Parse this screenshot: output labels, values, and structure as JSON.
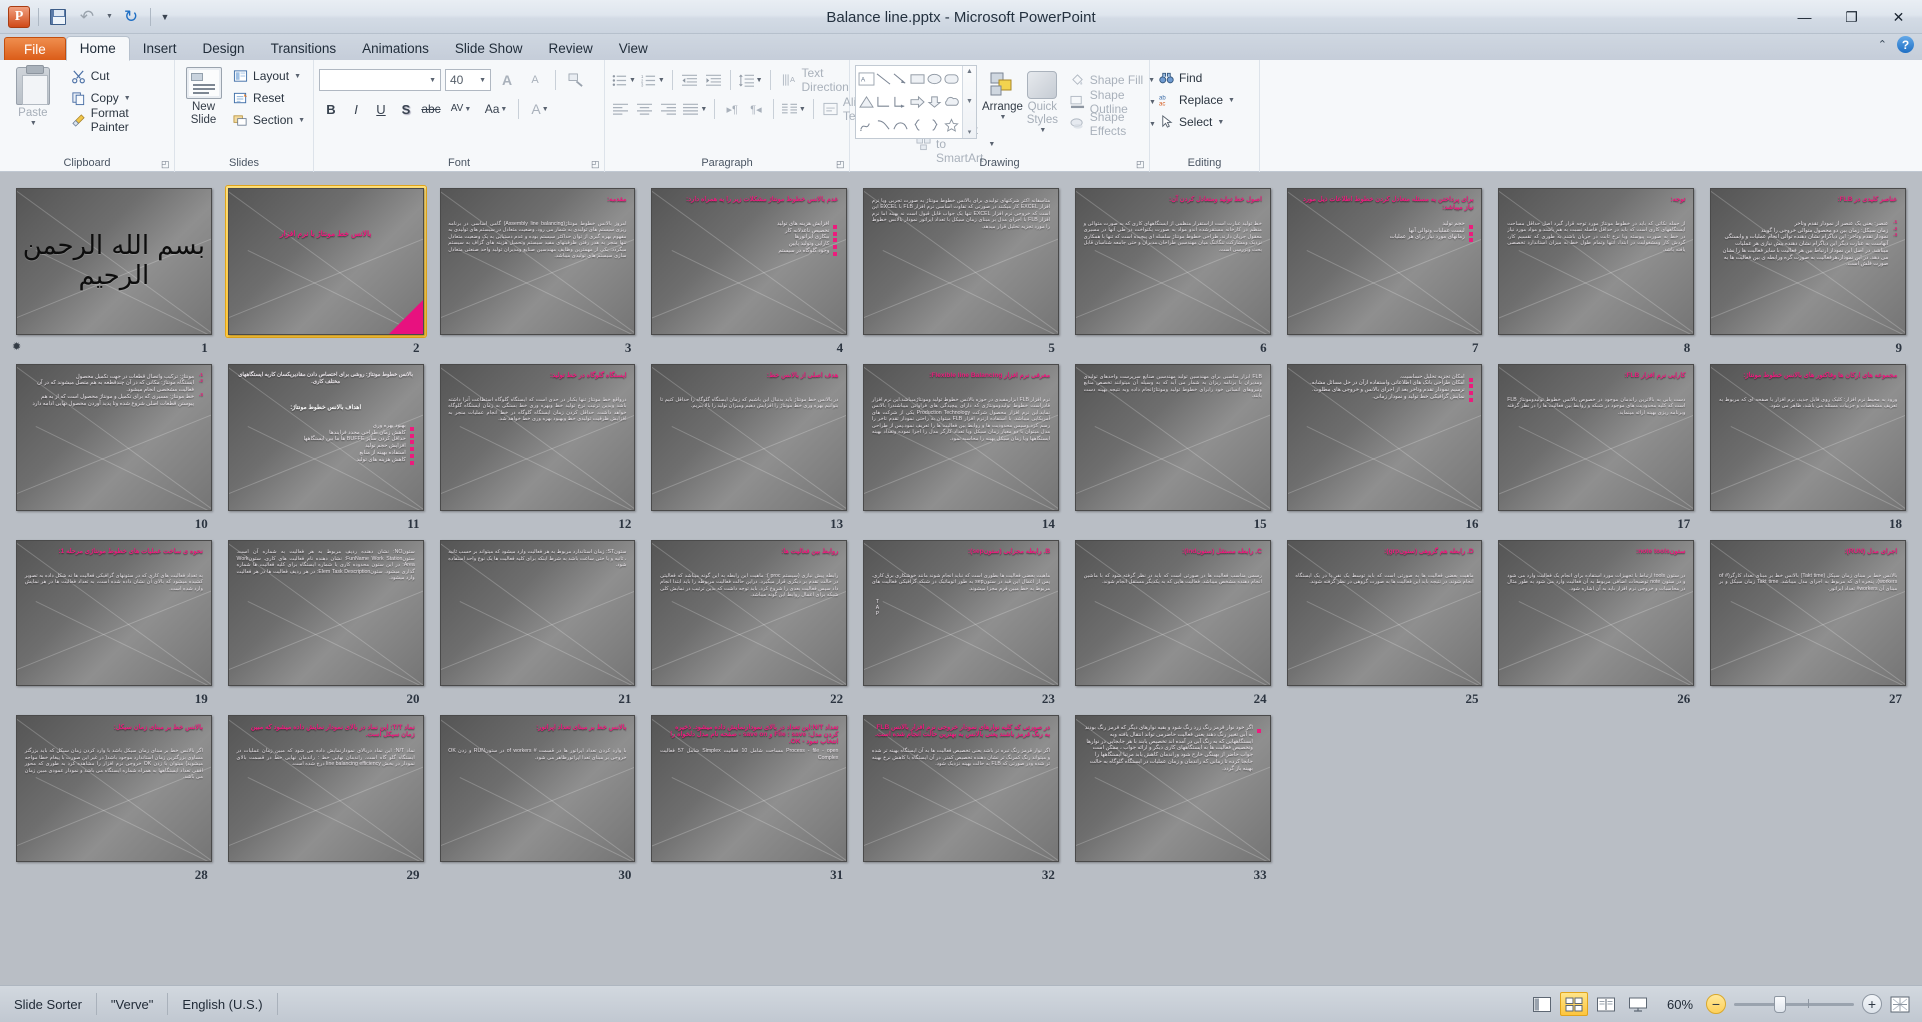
{
  "window": {
    "title": "Balance line.pptx  -  Microsoft PowerPoint",
    "minimize": "—",
    "restore": "❐",
    "close": "✕"
  },
  "qat": {
    "app_logo": "P",
    "save_icon": "save-icon",
    "undo_icon": "undo-icon",
    "redo_icon": "redo-icon",
    "customize_icon": "customize-qat-icon"
  },
  "tabs": [
    {
      "label": "File",
      "active": false,
      "file": true
    },
    {
      "label": "Home",
      "active": true,
      "file": false
    },
    {
      "label": "Insert",
      "active": false,
      "file": false
    },
    {
      "label": "Design",
      "active": false,
      "file": false
    },
    {
      "label": "Transitions",
      "active": false,
      "file": false
    },
    {
      "label": "Animations",
      "active": false,
      "file": false
    },
    {
      "label": "Slide Show",
      "active": false,
      "file": false
    },
    {
      "label": "Review",
      "active": false,
      "file": false
    },
    {
      "label": "View",
      "active": false,
      "file": false
    }
  ],
  "ribbon": {
    "groups": {
      "clipboard": {
        "label": "Clipboard",
        "paste": "Paste",
        "cut": "Cut",
        "copy": "Copy",
        "format_painter": "Format Painter"
      },
      "slides": {
        "label": "Slides",
        "new_slide": "New Slide",
        "layout": "Layout",
        "reset": "Reset",
        "section": "Section"
      },
      "font": {
        "label": "Font",
        "font_name": "",
        "font_name_placeholder": "",
        "font_size": "40",
        "bold": "B",
        "italic": "I",
        "underline": "U",
        "shadow": "S",
        "strikethrough": "abc",
        "character_spacing": "AV",
        "change_case": "Aa",
        "font_color": "A",
        "grow_font": "A",
        "shrink_font": "A",
        "clear_formatting": "clear-formatting-icon"
      },
      "paragraph": {
        "label": "Paragraph",
        "text_direction": "Text Direction",
        "align_text": "Align Text",
        "convert_to_smartart": "Convert to SmartArt"
      },
      "drawing": {
        "label": "Drawing",
        "arrange": "Arrange",
        "quick_styles": "Quick Styles",
        "shape_fill": "Shape Fill",
        "shape_outline": "Shape Outline",
        "shape_effects": "Shape Effects"
      },
      "editing": {
        "label": "Editing",
        "find": "Find",
        "replace": "Replace",
        "select": "Select"
      }
    },
    "collapse_icon": "chevron-up-icon",
    "help_icon": "help-icon"
  },
  "statusbar": {
    "view_name": "Slide Sorter",
    "theme": "\"Verve\"",
    "language": "English (U.S.)",
    "zoom_level": "60%",
    "views": [
      {
        "name": "normal-view",
        "active": false
      },
      {
        "name": "slide-sorter-view",
        "active": true
      },
      {
        "name": "reading-view",
        "active": false
      },
      {
        "name": "slide-show-view",
        "active": false
      }
    ],
    "zoom_out": "−",
    "zoom_in": "+",
    "fit_to_window": "fit-slide-to-window-icon"
  },
  "slides": [
    {
      "number": "1",
      "selected": false,
      "has_animation": true,
      "type": "calligraphy",
      "calligraphy": "بسم الله الرحمن الرحیم"
    },
    {
      "number": "2",
      "selected": true,
      "type": "title",
      "title": "بالانس خط مونتاژ با نرم افزار",
      "corner_triangle": true
    },
    {
      "number": "3",
      "selected": false,
      "type": "title-body",
      "title": "مقدمه:",
      "body": "امروز بالانس خطوط مونتاژ(Assembly line balancing) گامی اساسی در برنامه ریزی سیستم های تولیدی به شمار می رود. وضعیت متعادل در سیستم های تولیدی به مفهوم بهره گیری از توان حداکثر سیستم بوده و عدم دستیابی به یک وضعیت متعادل تنها منجر به هدر رفتن ظرفیتهای مفید سیستم وتحمیل هزینه های گزاف به سیستم میگردد. یکی از مهمترین وظایف مهندسین صنایع ومدیران تولید واحد صنعتی متعادل سازی سیستم های تولیدی میباشد."
    },
    {
      "number": "4",
      "selected": false,
      "type": "title-list",
      "title": "عدم بالانس خطوط مونتاژ مشکلات زیر را به همراه دارد:",
      "items": [
        "افزایش هزینه های تولید",
        "تخصیص ناعدلانه کار",
        "بیکاری اپراتورها",
        "کارایی وتولید پایین",
        "وجود گلوگاه در سیستم"
      ]
    },
    {
      "number": "5",
      "selected": false,
      "type": "body",
      "body": "متاسفانه اکثر شرکتهای تولیدی برای بالانس خطوط مونتاژ به صورت تجربی ویا نرم افزار EXCEL کار میکنند در صورتی که تفاوت اساسی نرم افزار FLB با EXCEL این است که خروجی نرم افزار EXCEL تنها یک جواب قابل قبول است نه بهینه اما نرم افزار FLB با اجرای مدل بر مبنای زمان سیکل با تعداد اپراتور نمودار بالانس خطوط را مورد تجزیه تحلیل قرار میدهد."
    },
    {
      "number": "6",
      "selected": false,
      "type": "title-body",
      "title": "اصول خط تولید ومتعادل کردن آن:",
      "body": "خط تولید عبارت است ازاستقرار منظمی از ایستگاههای کاری که به صورت متوالی و منظم در کارخانه مستقرشده اندو مواد به صورت یکنواخت در طی آنها در مسیری معقول جریان دارند. طراحی خطوط مونتاژ سلسله ای پیچیده است که تنها با همکاری نزدیک ومشارکت تنگاتنگ میان مهندسین طراحان،مدیران و حتی جامعه شناسان قابل بحث وبررسی است."
    },
    {
      "number": "7",
      "selected": false,
      "type": "title-list",
      "title": "برای پرداختن به مسئله متعادل کردن خطوط اطلاعات ذیل مورد نیاز میباشد:",
      "items": [
        "حجم تولید",
        "لیست عملیات وتوالی آنها",
        "زمانهای مورد نیاز برای هر عملیات"
      ]
    },
    {
      "number": "8",
      "selected": false,
      "type": "title-body",
      "title": "توجه:",
      "body": "از جمله نکاتی که باید در خطوط مونتاژ مورد توجه قرار گیرد اصل حداقل مساحت ایستگاههای کاری است که باید در حداقل فاصله نسبت به هم باشند.و مواد مورد نیاز در خط به صورت پیوسته وبا نرخ ثابت در جریان باشند به طوری که تقسیم کار، گردش کار ومشغولیت در ابتدا، انتها وتمام طول خط به میزان استاندارد تخصصی یافته باشد."
    },
    {
      "number": "9",
      "selected": false,
      "type": "title-numbered",
      "title": "عناصر کلیدی در FLB:",
      "items": [
        "عنصر: یعنی یک عنصر از نمودار تقدم وتاخر",
        "زمان سیکل: زمان بین دو محصول متوالی خروجی را گویند",
        "نمودار تقدم وتاخر: این دیاگرام نشان دهنده توالی انجام عملیات و وابستگی آنهاست به عبارت دیگر این دیاگرام نشان دهنده پیش نیازی هر عملیات میباشد. در اصل این نمودار ارتباط بین هر فعالیت با سایر فعالیت ها را نشان می دهد. در این نمودار،هرفعالیت به صورت گره ورابطه ی بین فعالیت ها به صورت فلش است."
      ]
    },
    {
      "number": "10",
      "selected": false,
      "type": "numbered-start4",
      "items": [
        "مونتاژ: ترکیب واتصال قطعات در جهت تکمیل محصول",
        "ایستگاه مونتاژ: مکانی که در آن چندقطعه به هم متصل میشوند که در آن فعالیت مشخصی انجام میشود.",
        "خط مونتاژ: مسیری که برای تکمیل و مونتاژ محصول است که از به هم پیوستن قطعات اصلی شروع شده وتا پدید آوردن محصول نهایی ادامه دارد"
      ]
    },
    {
      "number": "11",
      "selected": false,
      "type": "mixed-11",
      "lead": "بالانس خطوط مونتاژ: روشی برای اختصاص دادن مقادیریکسان کاربه ایستگاههای مختلف کاری.",
      "subtitle": "اهداف بالانس خطوط مونتاژ:",
      "items": [
        "بهبود بهره وری",
        "کاهش زمان طراحی مجدد فرایندها",
        "حداقل کردن سایز BUFFE ها ما بین ایستگاهها",
        "افزایش حجم تولید",
        "استفاده بهینه از منابع",
        "کاهش هزینه های تولید"
      ]
    },
    {
      "number": "12",
      "selected": false,
      "type": "title-body",
      "title": "ایستگاه گلوگاه در خط تولید:",
      "body": "درواقع خط مونتاژ تنها یکبار در حدی است که ایستگاه گلوگاه استطاعت آنرا داشته باشد وبدین ترتیب نرخ تولید خط وبهره وری خط بستگی به زمان ایستگاه گلوگاه خواهد داشت. حداقل کردن زمان ایستگاه گلوگاه در خط انجام عملیات منجر به افزایش ظرفیت تولیدی خط وبهبود بهره وری خط خواهد شد."
    },
    {
      "number": "13",
      "selected": false,
      "type": "title-body",
      "title": "هدف اصلی از بالانس خط:",
      "body": "در بالانس خط مونتاژ باید بدنبال این باشیم که زمان ایستگاه گلوگاه را حداقل کنیم تا بتوانیم بهره وری خط مونتاژ را افزایش دهیم ومیزان تولید را بالا ببریم."
    },
    {
      "number": "14",
      "selected": false,
      "type": "title-body",
      "title": "معرفی نرم افزار Flexible line Balancing:",
      "body": "نرم افزار FLB ابزارمفیدی در حوزه بالانس خطوط تولید ومونتاژمیباشد.این نرم افزار قادراست خطوط تولیدومونتاژی که دارای پیچیدگی های فراوانی میباشندرا بالانس نماید.این نرم افزار محصول شرکت Production Technology یکی از شرکت های آمریکایی میباشد. با استفاده ازنرم افزار FLB میتوان به راحتی نمودار تقدم تاخر را رسم کرد وسپس محدودیت ها و روابط بین فعالیت ها را تعریف نمود.پس از طراحی مدل میتوان با دو معیار زمان سیکل ویا تعداد کارگر مدل را اجرا نموده وتعداد بهینه ایستگاهها ویا زمان سیکل بهینه را محاسبه نمود."
    },
    {
      "number": "15",
      "selected": false,
      "type": "body",
      "body": "FLB ابزار مناسبی برای مهندسین تولید مهندسین صنایع سرپرست واحدهای تولیدی ومدیران با برنامه ریزان به شمار می آید که به وسیله آن میتوانند تخصص منابع ونیروهای انسانی خود رابرای خطوط تولید ومونتاژانجام داده وبه نتیجه بهینه دست یابند."
    },
    {
      "number": "16",
      "selected": false,
      "type": "list-16",
      "items": [
        "امکان تجزیه تحلیل حساسیت.",
        "امکان طراحی بانک های اطلاعاتی واستفاده ازآن در حل مسائل مشابه.",
        "ترسیم نمودار تقدم وتاخر بعد از اجرای بالانس و خروجی های مطلوب.",
        "نمایش گرافیکی خط تولید و نمودار زمانی."
      ]
    },
    {
      "number": "17",
      "selected": false,
      "type": "title-body",
      "title": "کارایی نرم افزار FLB:",
      "body": "دست یابی به بالاترین راندمان موجود در خصوص بالانس خطوط تولیدومونتاژ FLB است که کلیه محدودیت های موجود در شبکه و روابط بین فعالیت ها را در نظر گرفته وبرنامه ریزی بهینه ارائه مینماید."
    },
    {
      "number": "18",
      "selected": false,
      "type": "title-body-18",
      "title": "مجموعه های ارکان ها وفاکتور های بالانس خطوط مونتاژ:",
      "body": "ورود به محیط نرم افزار: کلیک روی فایل جدید، نرم افزار با صفحه ای که مربوط به تعریف مشخصات و جزییات مسئله می باشد، ظاهر می شود."
    },
    {
      "number": "19",
      "selected": false,
      "type": "title-body",
      "title": "نحوه ی ساخت عملیات های خطوط مونتاژی مرحله 1:",
      "body": "به تعداد فعالیت های کاری که در ستونهای گرافیکی فعالیت ها نه شکل داده به تصویر کشیده میشود که بالای آن نشان داده شده است، به تعداد فعالیت ها در هر نمایش وارد شده است."
    },
    {
      "number": "20",
      "selected": false,
      "type": "body-20",
      "body": "ستونNO: نشان دهنده ردیف مربوط به هر فعالیت به شماره آن است. ستونFunName Work Station: نشان دهنده نام فعالیت های کاری. ستونWork Area: در این ستون محدوده کاری یا شماره ایستگاه برای کلیه فعالیت ها شماره گذاری میشود. ستونElem Task Description: در هر ردیف فعالیت ها در هر فعالیت وارد میشود."
    },
    {
      "number": "21",
      "selected": false,
      "type": "body-21",
      "body": "ستونST: زمان استاندارد مربوط به هر فعالیت وارد میشود که میتواند بر حسب ثانیه ، ثانیه و یا حتی ساعت باشد به شرط اینکه برای کلیه فعالیت ها یک نوع واحد استفاده شود."
    },
    {
      "number": "22",
      "selected": false,
      "type": "title-body",
      "title": "روابط بین فعالیت ها:",
      "body": "رابطه پیش نیازی (سیستم proc ): ماهیت این رابطه به این گونه میباشد که فعالیتی در حالت تقدم بر دیگری قرار میگیرد. دراین حالت فعالیت مربوطه را باید ابتدا انجام داد سپس فعالیت بعدی را شروع کرد. باید توجه داشت که بدین ترتیب در نمایش کلی شبکه برای اعمال روابط این گونه میباشد."
    },
    {
      "number": "23",
      "selected": false,
      "type": "title-body-23",
      "title": "B. رابطه مجزایی (ستونsep):",
      "body": "ماهیت بعضی فعالیت ها بطوری است که نباید انجام شوند مانند خوشکاری برق کاری. پس از اعمال این قید در ستونsep به طور اتوماتیک در شبکه گرافیکی فعالیت های مربوط به خط مبین فرم مجزا میشوند.",
      "extra": "T\nA\nP"
    },
    {
      "number": "24",
      "selected": false,
      "type": "title-body-24",
      "title": "C. رابطه مستقل (ستونind):",
      "body": "رسمی مناسب فعالیت ها در صورتی است که باید در نظر گرفته شود که با ماشین انجام دهنده مشخص میباشد. فعالیت هایی که به یکدیگر مستقل انجام شوند."
    },
    {
      "number": "25",
      "selected": false,
      "type": "title-body-25",
      "title": "D. رابطه هم گروهی (ستونgrp):",
      "body": "ماهیت بعضی فعالیت ها به صورتی است که باید توسط یک نفر یا در یک ایستگاه انجام شوند. در نتیجه باید این فعالیت ها به صورت گروهی در نظر گرفته شوند."
    },
    {
      "number": "26",
      "selected": false,
      "type": "title-body-26",
      "title": "ستونnote tools:",
      "body": "در ستون tools ارتباط با تجهیزات مورد استفاده برای انجام یک فعالیت وارد می شود و در ستون note توضیحات اضافی مربوط به آن فعالیت وارد می شود به طور مثال در محاسبات و خروجی نرم افزار باید به آن اشاره شود."
    },
    {
      "number": "27",
      "selected": false,
      "type": "title-body-27",
      "title": "اجرای مدل (RUN):",
      "body": "بالانس خط بر مبنای زمان سیکل (Takt time) بالانس خط بر مبنای تعداد کارگر(# of workers). پنجره ای که مربوط به اجرای مدل میباشد. Takt time زمان سیکل و بر مبنای آن workers# تعداد اپراتور."
    },
    {
      "number": "28",
      "selected": false,
      "type": "title-body",
      "title": "بالانس خط بر مبنای زمان سیکل:",
      "body": "اگر بالانس خط بر مبنای زمان سیکل باشد با وارد کردن زمان سیکل که باید بزرگتر مساوی بزرگترین زمان استاندارد موجود باشد( در غیر این صورت با پیغام خطا مواجه میشوید) میتوان با زدن OK خروجی نرم افزار را مشاهده کرد به طوری که محور افقی تعداد ایستگاهها به همراه شماره ایستگاه می باشد و نمودار عمودی مبین زمان می باشد."
    },
    {
      "number": "29",
      "selected": false,
      "type": "title-body-29",
      "title": "نماد T/T: این نماد در بالای نمودار نمایش داده میشود که مبین زمان سیکل است.",
      "body": "نماد N/T: این نماد دربالای نمودارنمایش داده می شود که مبین زمان عملیات در ایستگاه گلو گاه است. راندمان نهایی خط : راندمان نهایی خط در قسمت بالای نمودار در بخش line balancing efficiency درج شده است."
    },
    {
      "number": "30",
      "selected": false,
      "type": "title-body",
      "title": "بالانس خط بر مبنای تعداد اپراتور:",
      "body": "با وارد کردن تعداد اپراتور ها در قسمت # of workers در ستونRUN و زدن OK خروجی بر مبنای تعدا اپراتورظاهر می شود."
    },
    {
      "number": "31",
      "selected": false,
      "type": "title-body-31",
      "title": "تعداد N/T:این تعداد در بالای نمودارنمایش داده میشود. ذخیره کردن مدل: File : save و save on - صفحه نام مدل دلخواه را انتخاب نمود - OK.",
      "body": "Process - file - open مساحت شامل 10 فعالیت Simplex شامل 57 فعالیت Complex"
    },
    {
      "number": "32",
      "selected": false,
      "type": "title-body-32",
      "title": "در صورتی که کلیه نوارهای نمودار خروجی نرم افزار بالانس FLB به رنگ قرمز باشند یعنی بالانس به بهترین حالت انجام شده است.",
      "body": "اگر نوار قرمز رنگ تیره تر باشد یعنی تخصیص فعالیت ها به آن ایستگاه بهینه تر شده و میتواند رنگ کمرنگ تر نشان دهنده تخصیص کمتر. در آن ایستگاه با کاهش نرخ بهینه تر شده ودر صورتی که FLB به حالت بهینه نزدیک شود."
    },
    {
      "number": "33",
      "selected": false,
      "type": "list-33",
      "items": [
        "اگر خود نوار قرمز رنگ زرد رنگ شود و بقیه نوارهای دیگر که قرمز رنگ بودند به آبی تغییر رنگ دهند یعنی فعالیت حاضرمی تواند انتقال یافته وبه ایستگاههایی که به رنگ آبی در آمده اند تخصیص یابند با هر جابجایی در نوارها وتخصیص فعالیت ها به ایستگاههای کاری دیگر و ارائه جواب ، ممکن است جواب حاضر از بهینگی خارج شود وراندمان کاهش یابد مرتبا ایستگاهها را جابجا کرده تا زمانی که راندمان و زمان عملیات در ایستگاه گلوگاه به حالت بهینه باز گردد."
      ]
    }
  ]
}
